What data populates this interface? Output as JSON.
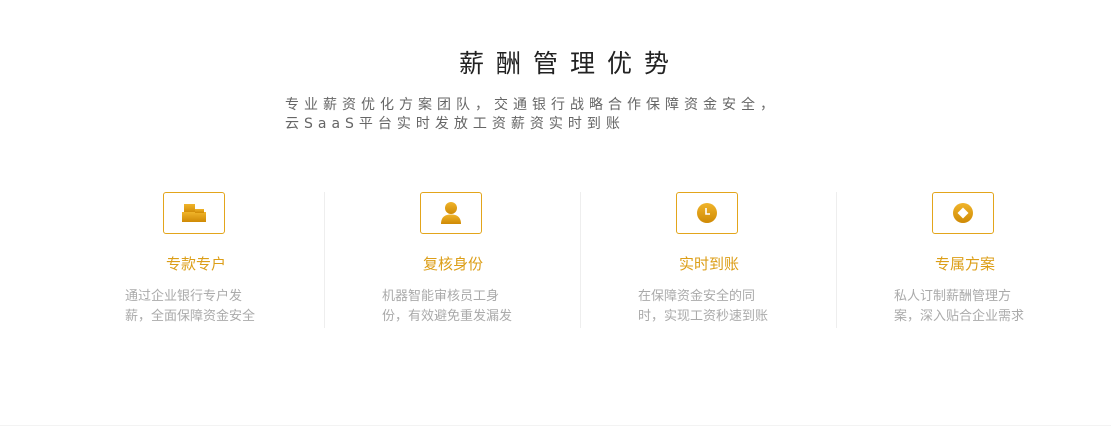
{
  "section": {
    "title": "薪酬管理优势",
    "subtitle_line1": "专业薪资优化方案团队，交通银行战略合作保障资金安全，",
    "subtitle_line2": "云SaaS平台实时发放工资薪资实时到账"
  },
  "features": [
    {
      "icon": "wallet-blocks-icon",
      "title": "专款专户",
      "desc_line1": "通过企业银行专户发",
      "desc_line2": "薪，全面保障资金安全"
    },
    {
      "icon": "user-icon",
      "title": "复核身份",
      "desc_line1": "机器智能审核员工身",
      "desc_line2": "份，有效避免重发漏发"
    },
    {
      "icon": "clock-icon",
      "title": "实时到账",
      "desc_line1": "在保障资金安全的同",
      "desc_line2": "时，实现工资秒速到账"
    },
    {
      "icon": "diamond-coin-icon",
      "title": "专属方案",
      "desc_line1": "私人订制薪酬管理方",
      "desc_line2": "案，深入贴合企业需求"
    }
  ],
  "colors": {
    "accent": "#dc9e17",
    "icon_gradient_top": "#f0b42a",
    "icon_gradient_bottom": "#cf8a05",
    "title_text": "#222222",
    "subtitle_text": "#666666",
    "desc_text": "#aaaaaa"
  }
}
